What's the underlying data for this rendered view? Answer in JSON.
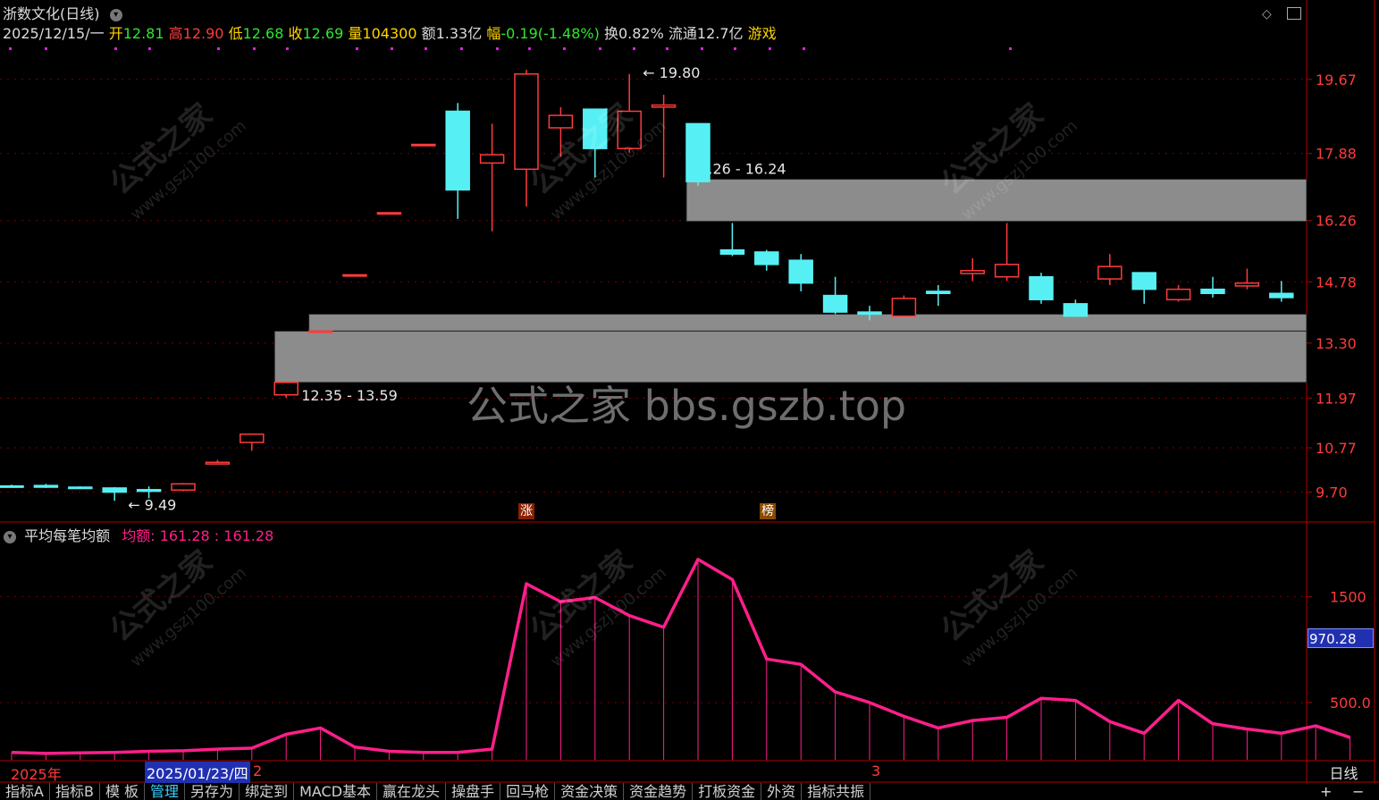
{
  "header": {
    "stock_name": "浙数文化(日线)",
    "date": "2025/12/15/一",
    "open_label": "开",
    "open": "12.81",
    "high_label": "高",
    "high": "12.90",
    "low_label": "低",
    "low": "12.68",
    "close_label": "收",
    "close": "12.69",
    "volume_label": "量",
    "volume": "104300",
    "amount_label": "额",
    "amount": "1.33亿",
    "change_label": "幅",
    "change": "-0.19(-1.48%)",
    "turnover_label": "换",
    "turnover": "0.82%",
    "float_label": "流通",
    "float_cap": "12.7亿",
    "sector": "游戏"
  },
  "indicator": {
    "name": "平均每笔均额",
    "series_label": "均额:",
    "value_a": "161.28",
    "value_b": "161.28",
    "cursor_value": "970.28"
  },
  "watermark_text": "公式之家 bbs.gszb.top",
  "bg_watermark": {
    "cn": "公式之家",
    "url": "www.gszj100.com"
  },
  "time_axis": {
    "year": "2025年",
    "cursor_date": "2025/01/23/四",
    "month_2": "2",
    "month_3": "3"
  },
  "period": "日线",
  "zoom": {
    "plus": "+",
    "minus": "−"
  },
  "tabs": [
    "指标A",
    "指标B",
    "模 板",
    "管理",
    "另存为",
    "绑定到",
    "MACD基本",
    "赢在龙头",
    "操盘手",
    "回马枪",
    "资金决策",
    "资金趋势",
    "打板资金",
    "外资",
    "指标共振"
  ],
  "active_tab": "管理",
  "badges": {
    "zhang": "涨",
    "bang": "榜"
  },
  "colors": {
    "up": "#ff3b3b",
    "down": "#56f0f4",
    "zone": "#8c8c8c",
    "line": "#ff1f8a",
    "grid": "#7a0000"
  },
  "chart_data": [
    {
      "type": "candlestick",
      "ylabels": [
        "19.67",
        "17.88",
        "16.26",
        "14.78",
        "13.30",
        "11.97",
        "10.77",
        "9.70"
      ],
      "yticks": [
        19.67,
        17.88,
        16.26,
        14.78,
        13.3,
        11.97,
        10.77,
        9.7
      ],
      "ylim": [
        9.0,
        20.4
      ],
      "candles": [
        {
          "o": 9.85,
          "h": 9.88,
          "l": 9.82,
          "c": 9.84
        },
        {
          "o": 9.86,
          "h": 9.9,
          "l": 9.8,
          "c": 9.82
        },
        {
          "o": 9.82,
          "h": 9.84,
          "l": 9.78,
          "c": 9.8
        },
        {
          "o": 9.8,
          "h": 9.82,
          "l": 9.49,
          "c": 9.7
        },
        {
          "o": 9.76,
          "h": 9.84,
          "l": 9.55,
          "c": 9.72
        },
        {
          "o": 9.75,
          "h": 9.92,
          "l": 9.72,
          "c": 9.9
        },
        {
          "o": 10.38,
          "h": 10.48,
          "l": 10.38,
          "c": 10.42
        },
        {
          "o": 10.9,
          "h": 11.1,
          "l": 10.7,
          "c": 11.1
        },
        {
          "o": 12.05,
          "h": 12.35,
          "l": 11.98,
          "c": 12.35
        },
        {
          "o": 13.59,
          "h": 13.59,
          "l": 13.59,
          "c": 13.59
        },
        {
          "o": 14.95,
          "h": 14.95,
          "l": 14.95,
          "c": 14.95
        },
        {
          "o": 16.45,
          "h": 16.45,
          "l": 16.45,
          "c": 16.45
        },
        {
          "o": 18.1,
          "h": 18.1,
          "l": 18.1,
          "c": 18.1
        },
        {
          "o": 18.9,
          "h": 19.1,
          "l": 16.3,
          "c": 17.0
        },
        {
          "o": 17.65,
          "h": 18.6,
          "l": 16.0,
          "c": 17.85
        },
        {
          "o": 17.5,
          "h": 19.9,
          "l": 16.6,
          "c": 19.8
        },
        {
          "o": 18.5,
          "h": 19.0,
          "l": 17.8,
          "c": 18.8
        },
        {
          "o": 18.95,
          "h": 18.95,
          "l": 17.3,
          "c": 18.0
        },
        {
          "o": 18.0,
          "h": 19.8,
          "l": 17.9,
          "c": 18.9
        },
        {
          "o": 19.0,
          "h": 19.3,
          "l": 17.3,
          "c": 19.05
        },
        {
          "o": 18.6,
          "h": 18.6,
          "l": 17.1,
          "c": 17.2
        },
        {
          "o": 15.55,
          "h": 16.2,
          "l": 15.4,
          "c": 15.45
        },
        {
          "o": 15.5,
          "h": 15.55,
          "l": 15.05,
          "c": 15.2
        },
        {
          "o": 15.3,
          "h": 15.45,
          "l": 14.55,
          "c": 14.75
        },
        {
          "o": 14.45,
          "h": 14.9,
          "l": 14.0,
          "c": 14.05
        },
        {
          "o": 14.05,
          "h": 14.2,
          "l": 13.85,
          "c": 14.0
        },
        {
          "o": 13.95,
          "h": 14.45,
          "l": 13.95,
          "c": 14.38
        },
        {
          "o": 14.55,
          "h": 14.7,
          "l": 14.2,
          "c": 14.5
        },
        {
          "o": 14.98,
          "h": 15.35,
          "l": 14.8,
          "c": 15.05
        },
        {
          "o": 14.9,
          "h": 16.2,
          "l": 14.8,
          "c": 15.2
        },
        {
          "o": 14.9,
          "h": 15.0,
          "l": 14.25,
          "c": 14.35
        },
        {
          "o": 14.25,
          "h": 14.35,
          "l": 13.95,
          "c": 13.95
        },
        {
          "o": 14.85,
          "h": 15.45,
          "l": 14.7,
          "c": 15.15
        },
        {
          "o": 15.0,
          "h": 15.0,
          "l": 14.25,
          "c": 14.6
        },
        {
          "o": 14.35,
          "h": 14.7,
          "l": 14.3,
          "c": 14.6
        },
        {
          "o": 14.6,
          "h": 14.9,
          "l": 14.4,
          "c": 14.5
        },
        {
          "o": 14.68,
          "h": 15.1,
          "l": 14.6,
          "c": 14.75
        },
        {
          "o": 14.5,
          "h": 14.8,
          "l": 14.3,
          "c": 14.4
        }
      ],
      "zones": [
        {
          "label": "17.26 - 16.24",
          "from_index": 20,
          "low": 16.24,
          "high": 17.26
        },
        {
          "label": "13.59 - 14.00",
          "from_index": 9,
          "low": 13.59,
          "high": 14.0
        },
        {
          "label": "12.35 - 13.59",
          "from_index": 8,
          "low": 12.35,
          "high": 13.59
        }
      ],
      "annotations": [
        {
          "text": "9.49",
          "index": 3,
          "value": 9.49
        },
        {
          "text": "19.80",
          "index": 18,
          "value": 19.8
        }
      ]
    },
    {
      "type": "line",
      "name": "均额",
      "ylabels": [
        "1500",
        "500.0"
      ],
      "yticks": [
        1500,
        500
      ],
      "ylim": [
        -40,
        2000
      ],
      "values": [
        30,
        20,
        25,
        30,
        40,
        45,
        60,
        70,
        200,
        260,
        80,
        40,
        30,
        30,
        60,
        1620,
        1450,
        1490,
        1320,
        1210,
        1850,
        1660,
        910,
        860,
        600,
        500,
        370,
        260,
        330,
        360,
        540,
        520,
        320,
        210,
        520,
        300,
        250,
        210,
        280,
        170
      ]
    }
  ]
}
